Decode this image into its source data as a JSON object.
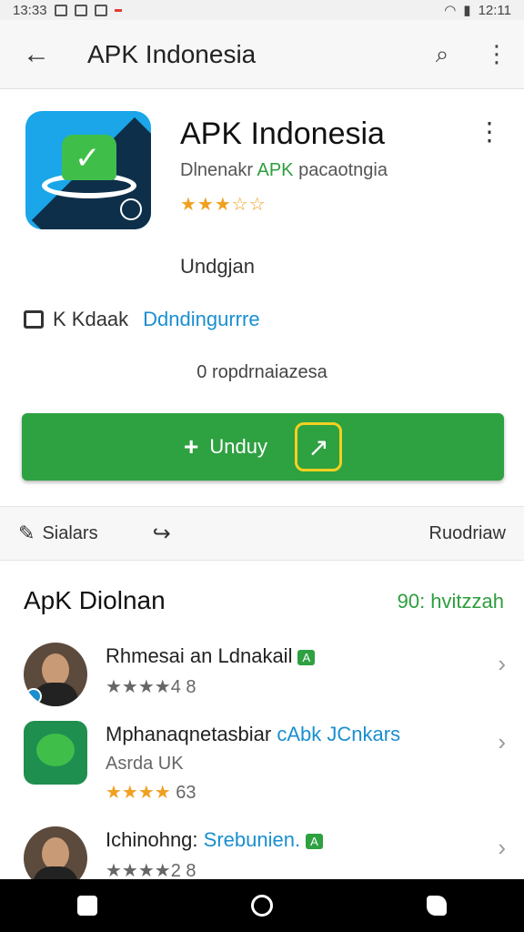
{
  "status_bar": {
    "time_left": "13:33",
    "time_right": "12:11"
  },
  "app_bar": {
    "title": "APK Indonesia",
    "back_icon": "arrow-left-icon",
    "search_icon": "search-icon",
    "more_icon": "more-vert-icon"
  },
  "app": {
    "name": "APK Indonesia",
    "developer_prefix": "Dlnenakr ",
    "developer_highlight": "APK",
    "developer_suffix": " pacaotngia",
    "rating_stars": 3.5,
    "rating_display": "★★★☆☆",
    "downloads_label": "Undgjan",
    "meta_label": "K Kdaak",
    "meta_link": "Ddndingurrre",
    "size_text": "0 ropdrnaiazesa",
    "install_label": "Unduy",
    "install_plus": "+"
  },
  "actions": {
    "left_label": "Sialars",
    "right_label": "Ruodriaw"
  },
  "section": {
    "title": "ApK Diolnan",
    "more": "90: hvitzzah",
    "items": [
      {
        "name": "Rhmesai an Ldnakail",
        "tag": "A",
        "sub": "★★★★4 8"
      },
      {
        "name_a": "Mphanaqnetasbiar ",
        "name_b": "cAbk JCnkars",
        "sub": "Asrda UK",
        "sub2_stars": "★★★★",
        "sub2_num": " 63"
      },
      {
        "name_a": "Ichinohng: ",
        "name_b": "Srebunien.",
        "tag": "A",
        "sub": "★★★★2 8"
      }
    ]
  },
  "colors": {
    "accent_green": "#2ea141",
    "link_blue": "#1a8fd0",
    "star_gold": "#f0a020"
  }
}
